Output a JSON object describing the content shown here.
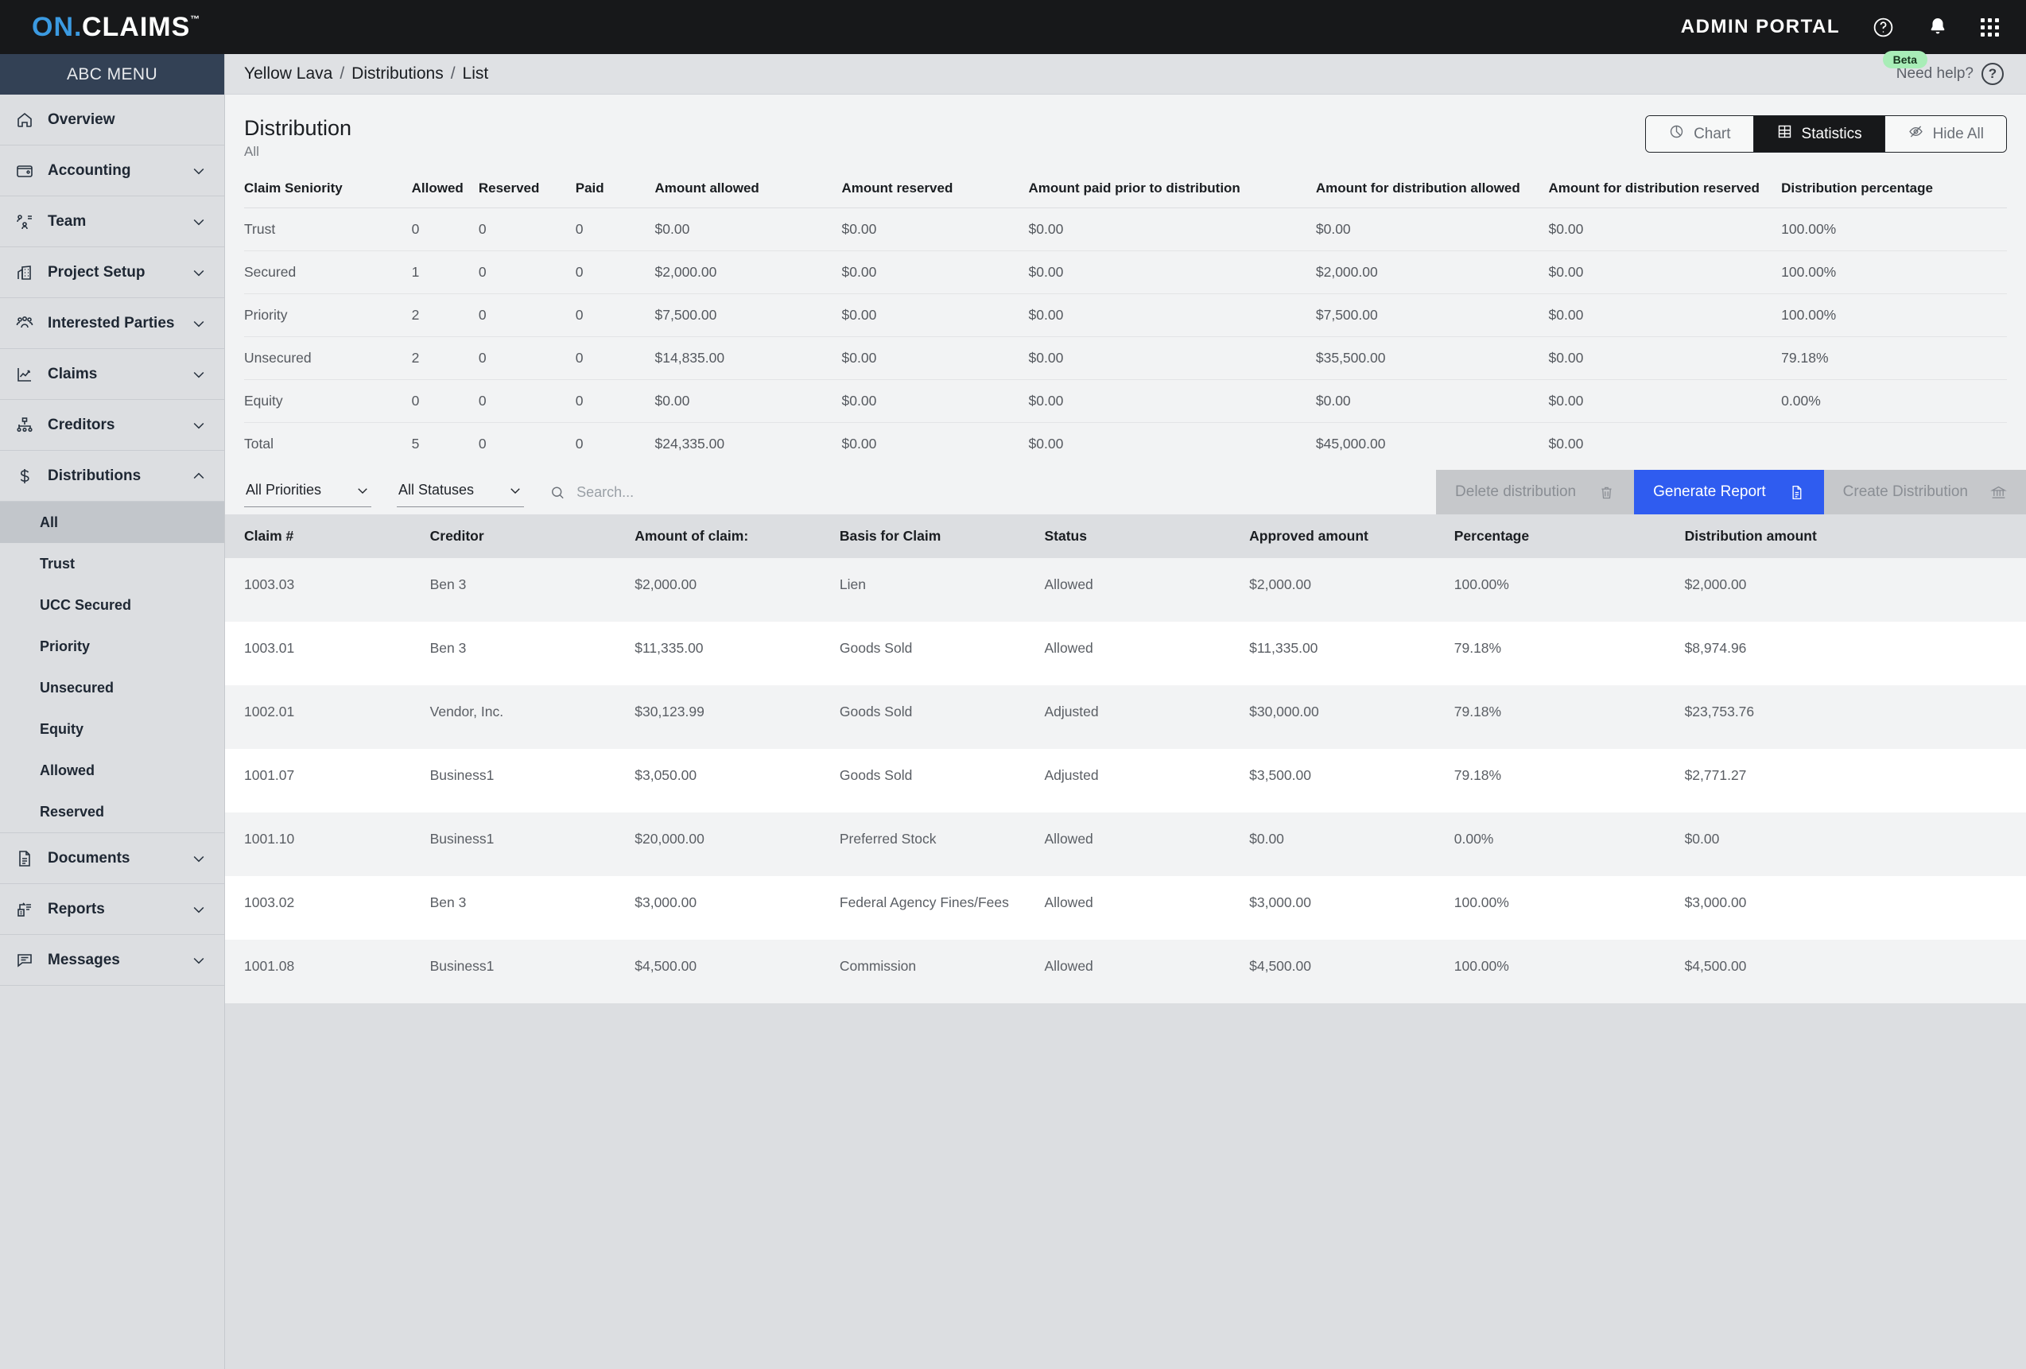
{
  "topbar": {
    "logo_on": "ON",
    "logo_dot": ".",
    "logo_claims": "CLAIMS",
    "logo_tm": "™",
    "admin_portal": "ADMIN PORTAL",
    "icons": [
      "help-circle-icon",
      "bell-icon",
      "apps-grid-icon"
    ]
  },
  "sidebar": {
    "header": "ABC MENU",
    "items": [
      {
        "label": "Overview",
        "icon": "home-icon",
        "expandable": false
      },
      {
        "label": "Accounting",
        "icon": "wallet-icon",
        "expandable": true
      },
      {
        "label": "Team",
        "icon": "team-icon",
        "expandable": true
      },
      {
        "label": "Project Setup",
        "icon": "building-icon",
        "expandable": true
      },
      {
        "label": "Interested Parties",
        "icon": "people-icon",
        "expandable": true
      },
      {
        "label": "Claims",
        "icon": "chart-line-icon",
        "expandable": true
      },
      {
        "label": "Creditors",
        "icon": "hierarchy-icon",
        "expandable": true
      },
      {
        "label": "Distributions",
        "icon": "dollar-icon",
        "expandable": true,
        "expanded": true
      }
    ],
    "distribution_subitems": [
      {
        "label": "All",
        "active": true
      },
      {
        "label": "Trust",
        "active": false
      },
      {
        "label": "UCC Secured",
        "active": false
      },
      {
        "label": "Priority",
        "active": false
      },
      {
        "label": "Unsecured",
        "active": false
      },
      {
        "label": "Equity",
        "active": false
      },
      {
        "label": "Allowed",
        "active": false
      },
      {
        "label": "Reserved",
        "active": false
      }
    ],
    "bottom_items": [
      {
        "label": "Documents",
        "icon": "document-icon",
        "expandable": true
      },
      {
        "label": "Reports",
        "icon": "report-icon",
        "expandable": true
      },
      {
        "label": "Messages",
        "icon": "message-icon",
        "expandable": true
      }
    ]
  },
  "breadcrumb": {
    "items": [
      "Yellow Lava",
      "Distributions",
      "List"
    ],
    "separator": "/"
  },
  "help": {
    "beta_badge": "Beta",
    "need_help": "Need help?",
    "question_mark": "?"
  },
  "page": {
    "title": "Distribution",
    "subtitle": "All"
  },
  "view_toggle": {
    "buttons": [
      {
        "label": "Chart",
        "icon": "pie-chart-icon",
        "active": false
      },
      {
        "label": "Statistics",
        "icon": "table-icon",
        "active": true
      },
      {
        "label": "Hide All",
        "icon": "eye-off-icon",
        "active": false
      }
    ]
  },
  "statistics": {
    "headers": [
      "Claim Seniority",
      "Allowed",
      "Reserved",
      "Paid",
      "Amount allowed",
      "Amount reserved",
      "Amount paid prior to distribution",
      "Amount for distribution allowed",
      "Amount for distribution reserved",
      "Distribution percentage"
    ],
    "rows": [
      [
        "Trust",
        "0",
        "0",
        "0",
        "$0.00",
        "$0.00",
        "$0.00",
        "$0.00",
        "$0.00",
        "100.00%"
      ],
      [
        "Secured",
        "1",
        "0",
        "0",
        "$2,000.00",
        "$0.00",
        "$0.00",
        "$2,000.00",
        "$0.00",
        "100.00%"
      ],
      [
        "Priority",
        "2",
        "0",
        "0",
        "$7,500.00",
        "$0.00",
        "$0.00",
        "$7,500.00",
        "$0.00",
        "100.00%"
      ],
      [
        "Unsecured",
        "2",
        "0",
        "0",
        "$14,835.00",
        "$0.00",
        "$0.00",
        "$35,500.00",
        "$0.00",
        "79.18%"
      ],
      [
        "Equity",
        "0",
        "0",
        "0",
        "$0.00",
        "$0.00",
        "$0.00",
        "$0.00",
        "$0.00",
        "0.00%"
      ],
      [
        "Total",
        "5",
        "0",
        "0",
        "$24,335.00",
        "$0.00",
        "$0.00",
        "$45,000.00",
        "$0.00",
        ""
      ]
    ]
  },
  "filters": {
    "priority_select": "All Priorities",
    "status_select": "All Statuses",
    "search_placeholder": "Search...",
    "search_value": ""
  },
  "action_buttons": [
    {
      "label": "Delete distribution",
      "icon": "trash-icon",
      "state": "disabled"
    },
    {
      "label": "Generate Report",
      "icon": "file-text-icon",
      "state": "primary"
    },
    {
      "label": "Create Distribution",
      "icon": "bank-icon",
      "state": "disabled"
    }
  ],
  "claims_table": {
    "headers": [
      "Claim #",
      "Creditor",
      "Amount of claim:",
      "Basis for Claim",
      "Status",
      "Approved amount",
      "Percentage",
      "Distribution amount"
    ],
    "rows": [
      [
        "1003.03",
        "Ben 3",
        "$2,000.00",
        "Lien",
        "Allowed",
        "$2,000.00",
        "100.00%",
        "$2,000.00"
      ],
      [
        "1003.01",
        "Ben 3",
        "$11,335.00",
        "Goods Sold",
        "Allowed",
        "$11,335.00",
        "79.18%",
        "$8,974.96"
      ],
      [
        "1002.01",
        "Vendor, Inc.",
        "$30,123.99",
        "Goods Sold",
        "Adjusted",
        "$30,000.00",
        "79.18%",
        "$23,753.76"
      ],
      [
        "1001.07",
        "Business1",
        "$3,050.00",
        "Goods Sold",
        "Adjusted",
        "$3,500.00",
        "79.18%",
        "$2,771.27"
      ],
      [
        "1001.10",
        "Business1",
        "$20,000.00",
        "Preferred Stock",
        "Allowed",
        "$0.00",
        "0.00%",
        "$0.00"
      ],
      [
        "1003.02",
        "Ben 3",
        "$3,000.00",
        "Federal Agency Fines/Fees",
        "Allowed",
        "$3,000.00",
        "100.00%",
        "$3,000.00"
      ],
      [
        "1001.08",
        "Business1",
        "$4,500.00",
        "Commission",
        "Allowed",
        "$4,500.00",
        "100.00%",
        "$4,500.00"
      ]
    ]
  },
  "colors": {
    "brand_blue": "#3b9ae1",
    "primary_action": "#2f5cf0",
    "sidebar_header": "#334155",
    "topbar": "#17181a",
    "beta_badge": "#a8edb7"
  }
}
